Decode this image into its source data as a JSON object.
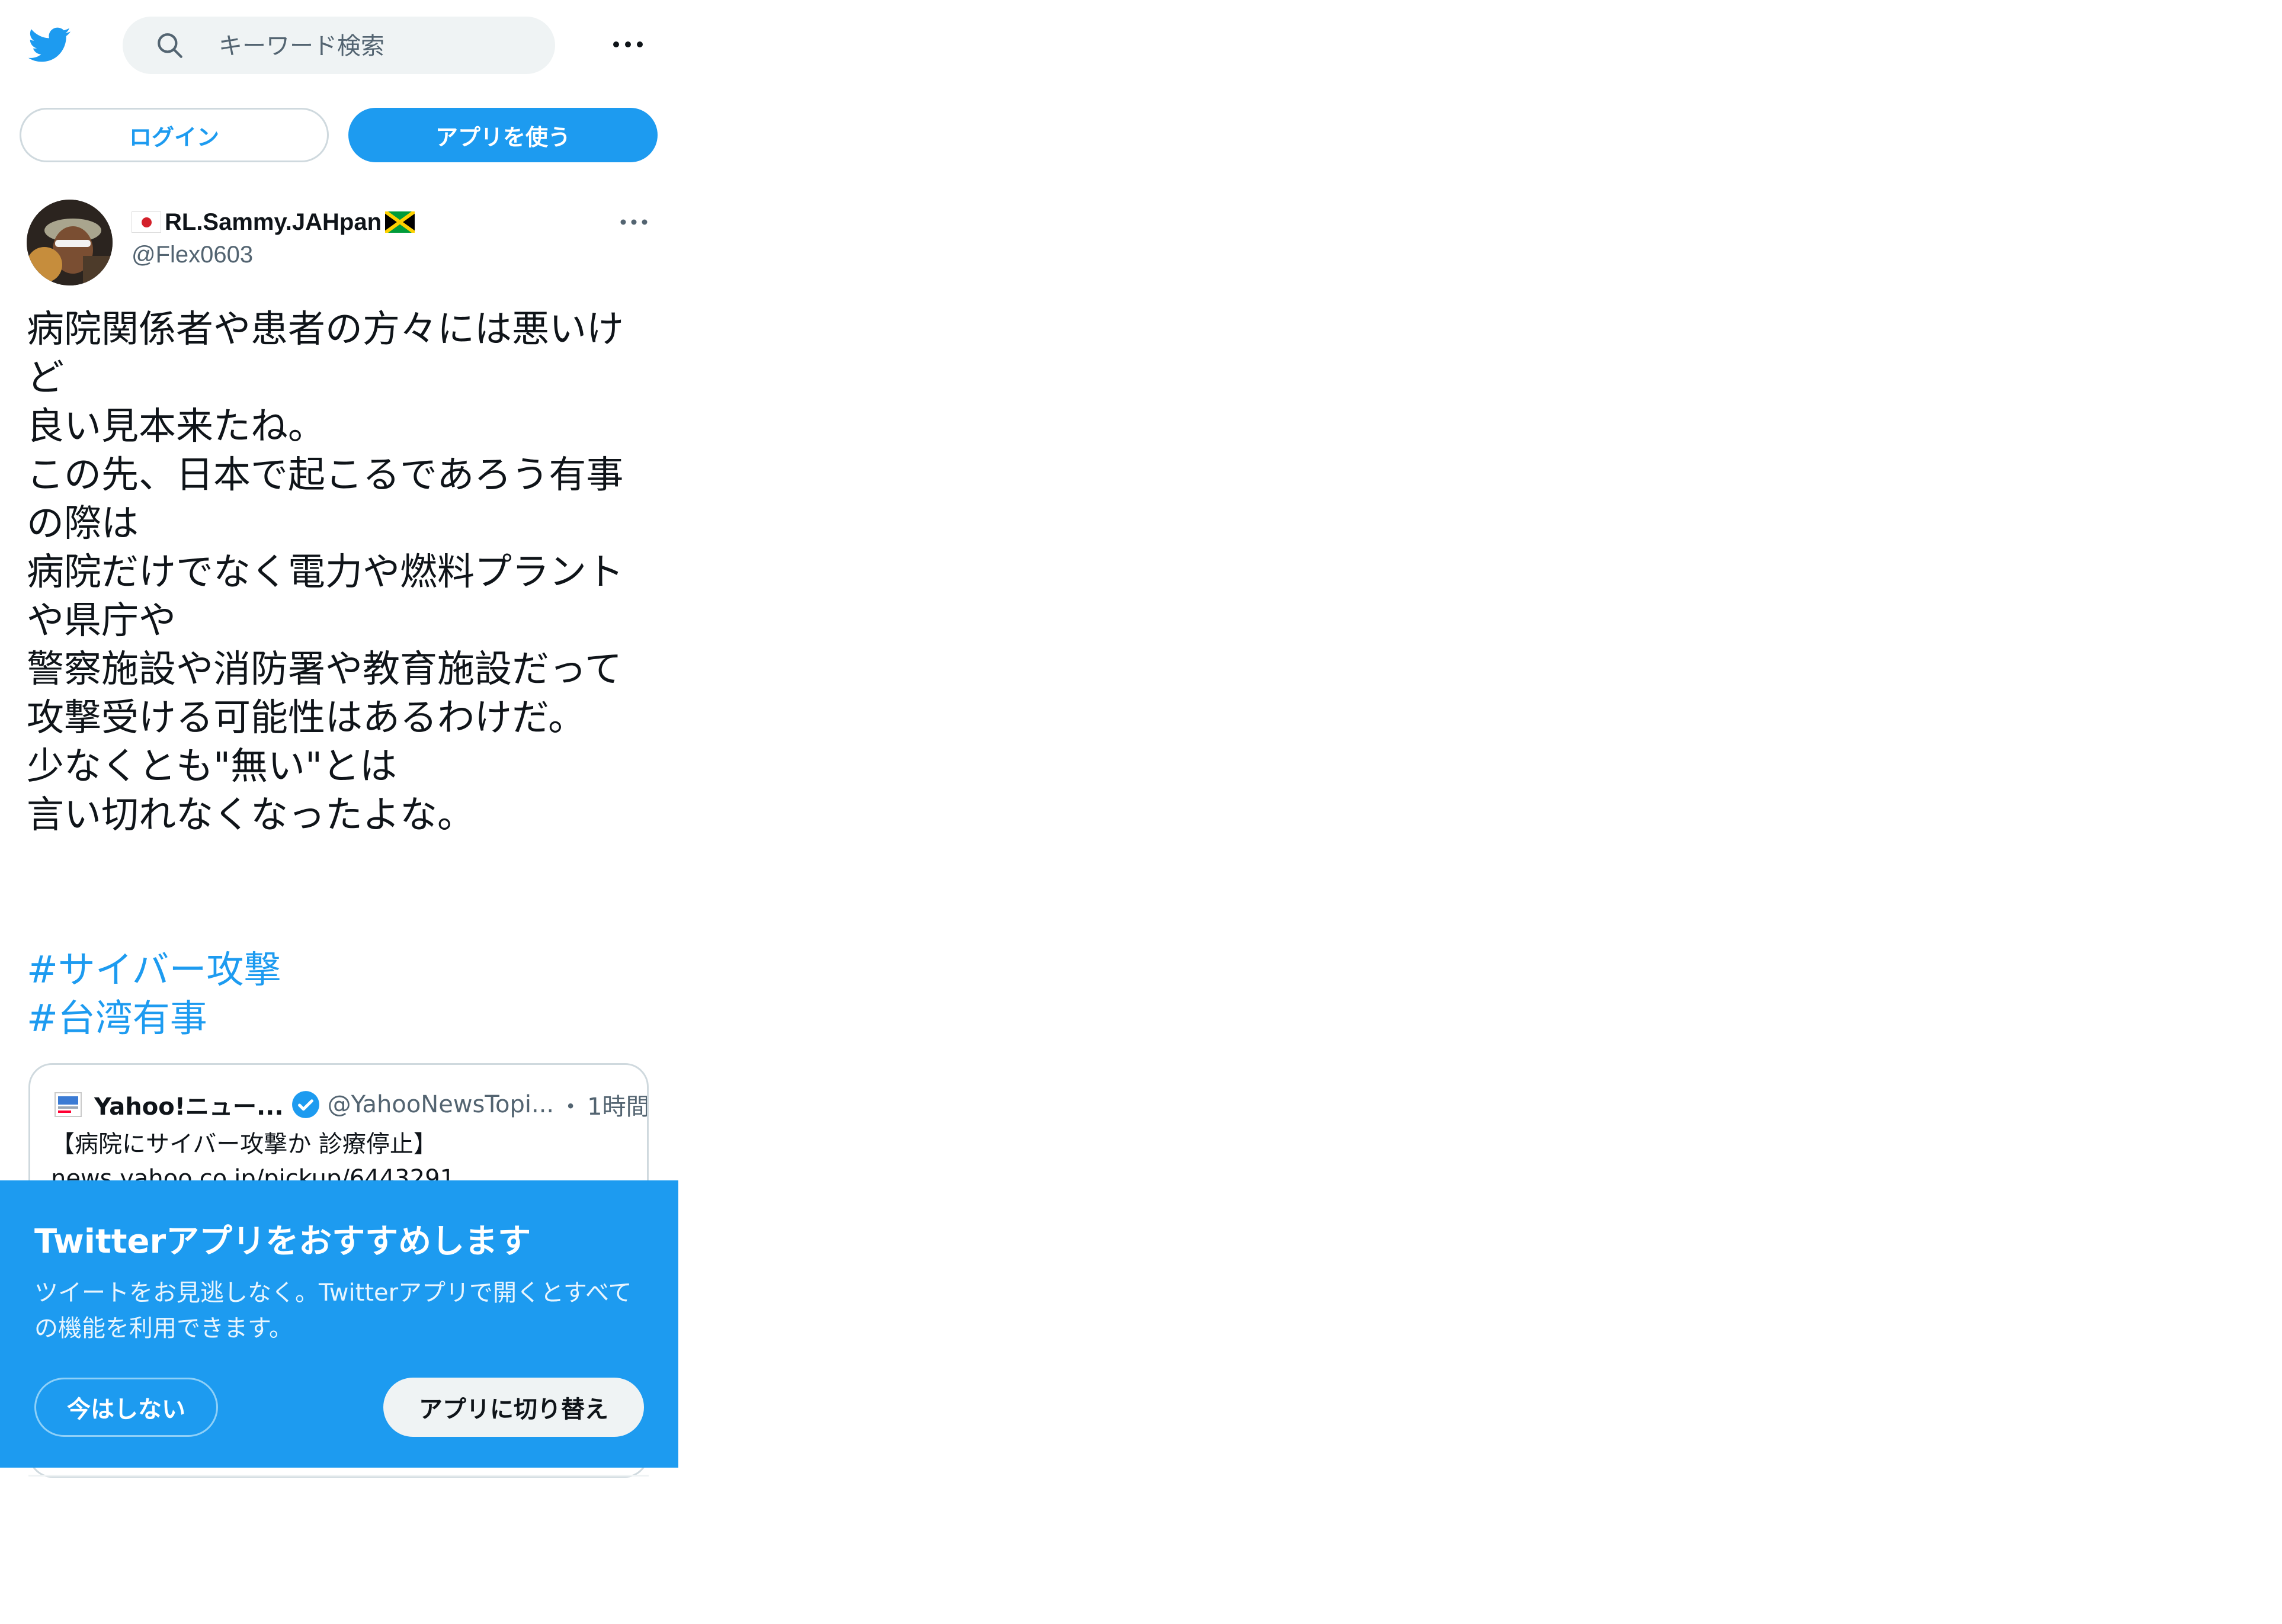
{
  "colors": {
    "brand": "#1d9bf0",
    "text_primary": "#0f1419",
    "text_secondary": "#536471",
    "search_bg": "#eff3f4",
    "border": "#cfd9de"
  },
  "header": {
    "logo_icon": "twitter-bird-icon",
    "search_placeholder": "キーワード検索",
    "search_icon": "search-icon",
    "more_icon": "more-horizontal-icon"
  },
  "auth": {
    "login_label": "ログイン",
    "use_app_label": "アプリを使う"
  },
  "tweet": {
    "author": {
      "display_name": "RL.Sammy.JAHpan",
      "handle": "@Flex0603",
      "flag_before": "japan-flag-icon",
      "flag_after": "jamaica-flag-icon"
    },
    "text": "病院関係者や患者の方々には悪いけど\n良い見本来たね。\nこの先、日本で起こるであろう有事の際は\n病院だけでなく電力や燃料プラントや県庁や\n警察施設や消防署や教育施設だって\n攻撃受ける可能性はあるわけだ。\n少なくとも\"無い\"とは\n言い切れなくなったよな。",
    "hashtags": [
      "#サイバー攻撃",
      "#台湾有事"
    ],
    "quoted": {
      "name": "Yahoo!ニュー...",
      "handle": "@YahooNewsTopi...",
      "separator": "・",
      "time": "1時間",
      "verified_icon": "verified-badge-icon",
      "text": "【病院にサイバー攻撃か 診療停止】\nnews.yahoo.co.jp/pickup/6443291"
    }
  },
  "promo": {
    "title": "Twitterアプリをおすすめします",
    "body": "ツイートをお見逃しなく。Twitterアプリで開くとすべての機能を利用できます。",
    "not_now_label": "今はしない",
    "switch_label": "アプリに切り替え"
  }
}
